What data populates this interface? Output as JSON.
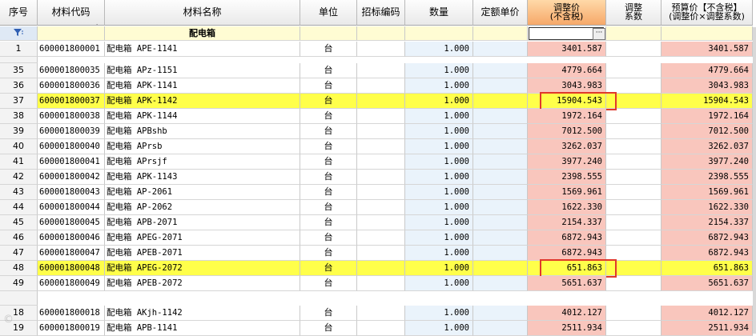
{
  "headers": {
    "idx": "序号",
    "code": "材料代码",
    "name": "材料名称",
    "unit": "单位",
    "bid": "招标编码",
    "qty": "数量",
    "fixed": "定额单价",
    "adj_l1": "调整价",
    "adj_l2": "(不含税)",
    "coef_l1": "调整",
    "coef_l2": "系数",
    "budget_l1": "预算价【不含税】",
    "budget_l2": "(调整价×调整系数)"
  },
  "filter_row": {
    "group_label": "配电箱",
    "filter_icon": "funnel-icon"
  },
  "rows": [
    {
      "idx": "1",
      "code": "600001800001",
      "name": "配电箱 APE-1141",
      "unit": "台",
      "qty": "1.000",
      "adj": "3401.587",
      "budget": "3401.587",
      "highlight": false
    },
    {
      "idx": "35",
      "code": "600001800035",
      "name": "配电箱 APz-1151",
      "unit": "台",
      "qty": "1.000",
      "adj": "4779.664",
      "budget": "4779.664",
      "highlight": false
    },
    {
      "idx": "36",
      "code": "600001800036",
      "name": "配电箱 APK-1141",
      "unit": "台",
      "qty": "1.000",
      "adj": "3043.983",
      "budget": "3043.983",
      "highlight": false
    },
    {
      "idx": "37",
      "code": "600001800037",
      "name": "配电箱 APK-1142",
      "unit": "台",
      "qty": "1.000",
      "adj": "15904.543",
      "budget": "15904.543",
      "highlight": true
    },
    {
      "idx": "38",
      "code": "600001800038",
      "name": "配电箱 APK-1144",
      "unit": "台",
      "qty": "1.000",
      "adj": "1972.164",
      "budget": "1972.164",
      "highlight": false
    },
    {
      "idx": "39",
      "code": "600001800039",
      "name": "配电箱 APBshb",
      "unit": "台",
      "qty": "1.000",
      "adj": "7012.500",
      "budget": "7012.500",
      "highlight": false
    },
    {
      "idx": "40",
      "code": "600001800040",
      "name": "配电箱 APrsb",
      "unit": "台",
      "qty": "1.000",
      "adj": "3262.037",
      "budget": "3262.037",
      "highlight": false
    },
    {
      "idx": "41",
      "code": "600001800041",
      "name": "配电箱 APrsjf",
      "unit": "台",
      "qty": "1.000",
      "adj": "3977.240",
      "budget": "3977.240",
      "highlight": false
    },
    {
      "idx": "42",
      "code": "600001800042",
      "name": "配电箱 APK-1143",
      "unit": "台",
      "qty": "1.000",
      "adj": "2398.555",
      "budget": "2398.555",
      "highlight": false
    },
    {
      "idx": "43",
      "code": "600001800043",
      "name": "配电箱 AP-2061",
      "unit": "台",
      "qty": "1.000",
      "adj": "1569.961",
      "budget": "1569.961",
      "highlight": false
    },
    {
      "idx": "44",
      "code": "600001800044",
      "name": "配电箱 AP-2062",
      "unit": "台",
      "qty": "1.000",
      "adj": "1622.330",
      "budget": "1622.330",
      "highlight": false
    },
    {
      "idx": "45",
      "code": "600001800045",
      "name": "配电箱 APB-2071",
      "unit": "台",
      "qty": "1.000",
      "adj": "2154.337",
      "budget": "2154.337",
      "highlight": false
    },
    {
      "idx": "46",
      "code": "600001800046",
      "name": "配电箱 APEG-2071",
      "unit": "台",
      "qty": "1.000",
      "adj": "6872.943",
      "budget": "6872.943",
      "highlight": false
    },
    {
      "idx": "47",
      "code": "600001800047",
      "name": "配电箱 APEB-2071",
      "unit": "台",
      "qty": "1.000",
      "adj": "6872.943",
      "budget": "6872.943",
      "highlight": false
    },
    {
      "idx": "48",
      "code": "600001800048",
      "name": "配电箱 APEG-2072",
      "unit": "台",
      "qty": "1.000",
      "adj": "651.863",
      "budget": "651.863",
      "highlight": true
    },
    {
      "idx": "49",
      "code": "600001800049",
      "name": "配电箱 APEB-2072",
      "unit": "台",
      "qty": "1.000",
      "adj": "5651.637",
      "budget": "5651.637",
      "highlight": false
    },
    {
      "idx": "18",
      "code": "600001800018",
      "name": "配电箱 AKjh-1142",
      "unit": "台",
      "qty": "1.000",
      "adj": "4012.127",
      "budget": "4012.127",
      "highlight": false
    },
    {
      "idx": "19",
      "code": "600001800019",
      "name": "配电箱 APB-1141",
      "unit": "台",
      "qty": "1.000",
      "adj": "2511.934",
      "budget": "2511.934",
      "highlight": false
    }
  ],
  "colors": {
    "highlight_row": "#ffff4a",
    "adj_column": "#f9c6bd",
    "qty_column": "#eaf3fb",
    "annotation_box": "#e0382b"
  }
}
